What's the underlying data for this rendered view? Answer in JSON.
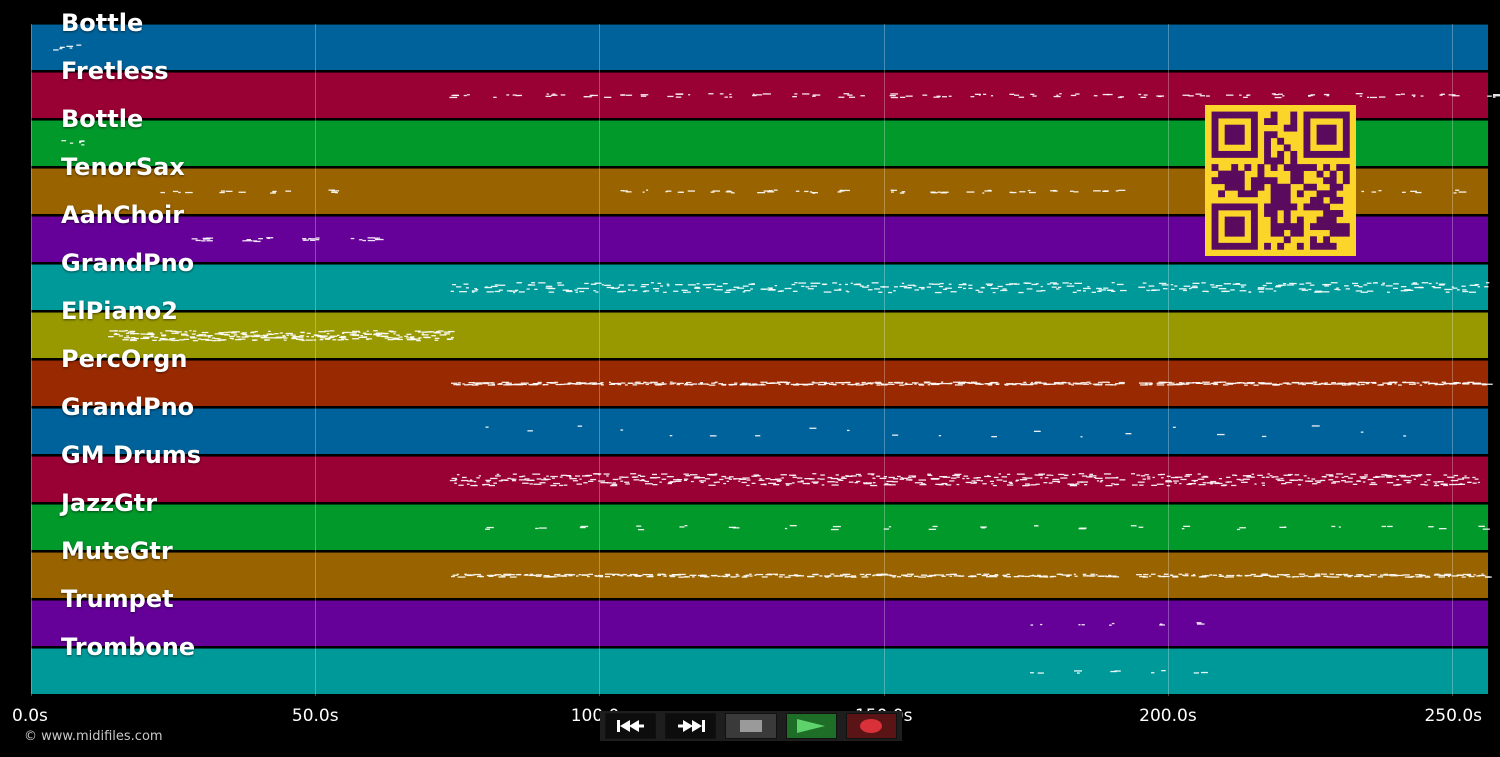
{
  "tracks": [
    {
      "name": "Bottle",
      "color": "#00629a"
    },
    {
      "name": "Fretless",
      "color": "#990033"
    },
    {
      "name": "Bottle",
      "color": "#00992a"
    },
    {
      "name": "TenorSax",
      "color": "#996300"
    },
    {
      "name": "AahChoir",
      "color": "#650099"
    },
    {
      "name": "GrandPno",
      "color": "#009999"
    },
    {
      "name": "ElPiano2",
      "color": "#989900"
    },
    {
      "name": "PercOrgn",
      "color": "#992900"
    },
    {
      "name": "GrandPno",
      "color": "#00629a"
    },
    {
      "name": "GM Drums",
      "color": "#990033"
    },
    {
      "name": "JazzGtr",
      "color": "#00992a"
    },
    {
      "name": "MuteGtr",
      "color": "#996300"
    },
    {
      "name": "Trumpet",
      "color": "#650099"
    },
    {
      "name": "Trombone",
      "color": "#009999"
    }
  ],
  "timeline": {
    "max_seconds": 256.3,
    "ticks": [
      {
        "seconds": 0,
        "label": "0.0s"
      },
      {
        "seconds": 50,
        "label": "50.0s"
      },
      {
        "seconds": 100,
        "label": "100.0s"
      },
      {
        "seconds": 150,
        "label": "150.0s"
      },
      {
        "seconds": 200,
        "label": "200.0s"
      },
      {
        "seconds": 250,
        "label": "250.0s"
      }
    ]
  },
  "copyright": "© www.midifiles.com",
  "transport": {
    "rewind_icon": "rewind-icon",
    "forward_icon": "fast-forward-icon",
    "stop_icon": "stop-icon",
    "play_icon": "play-icon",
    "record_icon": "record-icon",
    "play_color": "#2f9e3a",
    "record_color": "#c1272d"
  },
  "qr_code": {
    "icon": "qr-code-icon",
    "fg_color": "#5a0b5e",
    "bg_color": "#fcd52b"
  }
}
